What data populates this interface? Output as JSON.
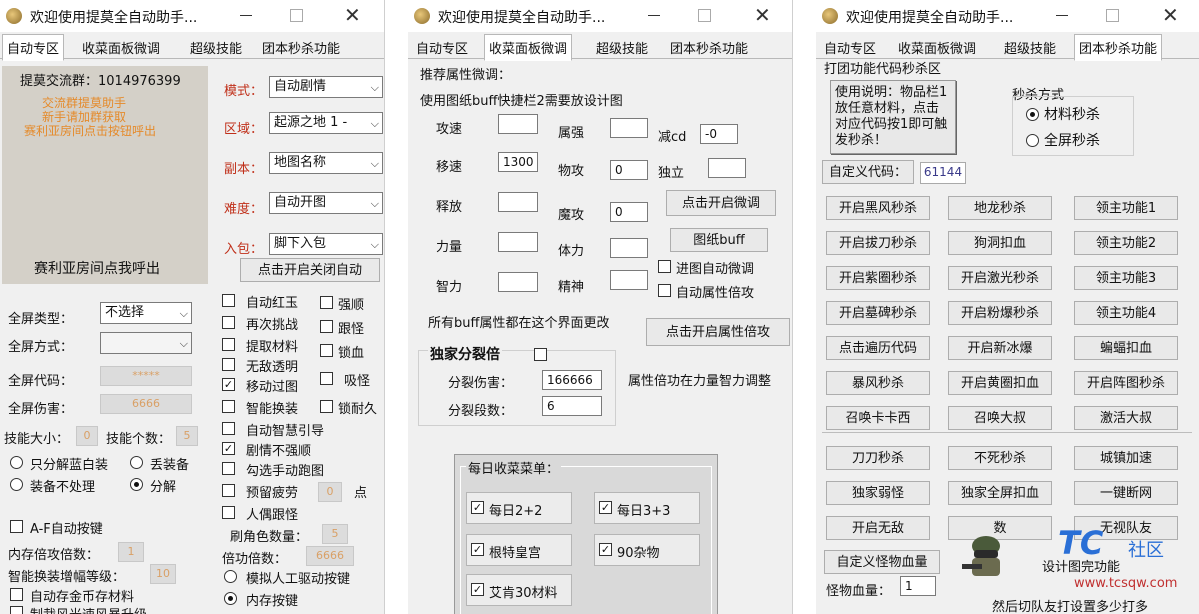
{
  "w1": {
    "title": "欢迎使用提莫全自动助手...",
    "tabs": [
      "自动专区",
      "收菜面板微调",
      "超级技能",
      "团本秒杀功能"
    ],
    "qq_group": "提莫交流群：1014976399",
    "notice": [
      "交流群提莫助手",
      "新手请加群获取",
      "赛利亚房间点击按钮呼出"
    ],
    "call_text": "赛利亚房间点我呼出",
    "modes": [
      {
        "label": "模式：",
        "value": "自动剧情"
      },
      {
        "label": "区域：",
        "value": "起源之地 1 -"
      },
      {
        "label": "副本：",
        "value": "地图名称"
      },
      {
        "label": "难度：",
        "value": "自动开图"
      },
      {
        "label": "入包：",
        "value": "脚下入包"
      }
    ],
    "toggle_auto": "点击开启关闭自动",
    "screen_type_label": "全屏类型：",
    "screen_type_value": "不选择",
    "screen_mode_label": "全屏方式：",
    "screen_code_label": "全屏代码：",
    "screen_code_value": "*****",
    "screen_dmg_label": "全屏伤害：",
    "screen_dmg_value": "6666",
    "skill_size_label": "技能大小：",
    "skill_size_value": "0",
    "skill_count_label": "技能个数：",
    "skill_count_value": "5",
    "decompose": [
      "只分解蓝白装",
      "丢装备",
      "装备不处理",
      "分解"
    ],
    "af_label": "A-F自动按键",
    "mem_atk_label": "内存倍攻倍数：",
    "mem_atk_value": "1",
    "smart_label": "智能换装增幅等级：",
    "smart_value": "10",
    "auto_gold_label": "自动存金币存材料",
    "cut_label": "制裁风光速风暴升级",
    "checks": [
      {
        "label": "自动红玉",
        "checked": false
      },
      {
        "label": "再次挑战",
        "checked": false
      },
      {
        "label": "提取材料",
        "checked": false
      },
      {
        "label": "无敌透明",
        "checked": false
      },
      {
        "label": "移动过图",
        "checked": true
      },
      {
        "label": "智能换装",
        "checked": false
      },
      {
        "label": "自动智慧引导",
        "checked": false
      },
      {
        "label": "剧情不强顺",
        "checked": true
      },
      {
        "label": "勾选手动跑图",
        "checked": false
      },
      {
        "label": "预留疲劳",
        "checked": false
      },
      {
        "label": "人偶跟怪",
        "checked": false
      }
    ],
    "checks2": [
      {
        "label": "强顺",
        "checked": false
      },
      {
        "label": "跟怪",
        "checked": false
      },
      {
        "label": "锁血",
        "checked": false
      },
      {
        "label": "吸怪",
        "checked": false
      },
      {
        "label": "锁耐久",
        "checked": false
      }
    ],
    "fatigue_value": "0",
    "fatigue_unit": "点",
    "brush_label": "刷角色数量：",
    "brush_value": "5",
    "multi_label": "倍功倍数：",
    "multi_value": "6666",
    "radio1": "模拟人工驱动按键",
    "radio2": "内存按键"
  },
  "w2": {
    "title": "欢迎使用提莫全自动助手...",
    "tabs": [
      "自动专区",
      "收菜面板微调",
      "超级技能",
      "团本秒杀功能"
    ],
    "recommend": "推荐属性微调：",
    "hint": "使用图纸buff快捷栏2需要放设计图",
    "attrs_left": [
      {
        "label": "攻速",
        "value": ""
      },
      {
        "label": "移速",
        "value": "1300"
      },
      {
        "label": "释放",
        "value": ""
      },
      {
        "label": "力量",
        "value": ""
      },
      {
        "label": "智力",
        "value": ""
      }
    ],
    "attrs_mid": [
      {
        "label": "属强",
        "value": ""
      },
      {
        "label": "物攻",
        "value": "0"
      },
      {
        "label": "魔攻",
        "value": "0"
      },
      {
        "label": "体力",
        "value": ""
      },
      {
        "label": "精神",
        "value": ""
      }
    ],
    "cd_label": "减cd",
    "cd_value": "-0",
    "indep_label": "独立",
    "indep_value": "",
    "btn_fine": "点击开启微调",
    "btn_buff": "图纸buff",
    "chk_map": "进图自动微调",
    "chk_attr": "自动属性倍攻",
    "all_note": "所有buff属性都在这个界面更改",
    "btn_attr": "点击开启属性倍攻",
    "split_title": "独家分裂倍",
    "split_dmg_label": "分裂伤害：",
    "split_dmg_value": "166666",
    "split_cnt_label": "分裂段数：",
    "split_cnt_value": "6",
    "attr_note": "属性倍功在力量智力调整",
    "menu_title": "每日收菜菜单：",
    "menu_items": [
      {
        "label": "每日2+2",
        "checked": true
      },
      {
        "label": "每日3+3",
        "checked": true
      },
      {
        "label": "根特皇宫",
        "checked": true
      },
      {
        "label": "90杂物",
        "checked": true
      },
      {
        "label": "艾肯30材料",
        "checked": true
      }
    ]
  },
  "w3": {
    "title": "欢迎使用提莫全自动助手...",
    "tabs": [
      "自动专区",
      "收菜面板微调",
      "超级技能",
      "团本秒杀功能"
    ],
    "area_title": "打团功能代码秒杀区",
    "usage": "使用说明：物品栏1放任意材料，点击对应代码按1即可触发秒杀！",
    "kill_mode": "秒杀方式",
    "radio_mat": "材料秒杀",
    "radio_full": "全屏秒杀",
    "custom_code_label": "自定义代码：",
    "custom_code_value": "61144",
    "buttons": [
      [
        "开启黑风秒杀",
        "地龙秒杀",
        "领主功能1"
      ],
      [
        "开启拔刀秒杀",
        "狗洞扣血",
        "领主功能2"
      ],
      [
        "开启紫圈秒杀",
        "开启激光秒杀",
        "领主功能3"
      ],
      [
        "开启墓碑秒杀",
        "开启粉爆秒杀",
        "领主功能4"
      ],
      [
        "点击遍历代码",
        "开启新冰爆",
        "蝙蝠扣血"
      ],
      [
        "暴风秒杀",
        "开启黄圈扣血",
        "开启阵图秒杀"
      ],
      [
        "召唤卡卡西",
        "召唤大叔",
        "激活大叔"
      ]
    ],
    "buttons2": [
      [
        "刀刀秒杀",
        "不死秒杀",
        "城镇加速"
      ],
      [
        "独家弱怪",
        "独家全屏扣血",
        "一键断网"
      ],
      [
        "开启无敌",
        "数",
        "无视队友"
      ]
    ],
    "custom_blood_btn": "自定义怪物血量",
    "monster_hp_label": "怪物血量：",
    "monster_hp_value": "1",
    "tail_text1": "设计图完功能",
    "tail_text2": "然后切队友打设置多少打多",
    "watermark_logo": "TC",
    "watermark_text": "社区",
    "watermark_url": "www.tcsqw.com"
  }
}
